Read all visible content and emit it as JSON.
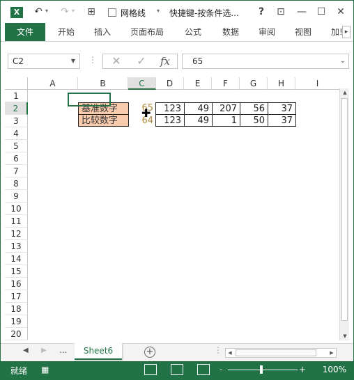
{
  "titlebar": {
    "logo": "X",
    "gridlines_label": "网格线",
    "doc_title": "快捷键-按条件选...",
    "help": "?",
    "ribbon_display": "⊡",
    "minimize": "—",
    "maximize": "☐",
    "close": "✕"
  },
  "ribbon": {
    "tabs": [
      "文件",
      "开始",
      "插入",
      "页面布局",
      "公式",
      "数据",
      "审阅",
      "视图",
      "加!"
    ]
  },
  "formula_bar": {
    "name_box": "C2",
    "cancel": "✕",
    "enter": "✓",
    "fx": "fx",
    "value": "65"
  },
  "grid": {
    "columns": [
      "A",
      "B",
      "C",
      "D",
      "E",
      "F",
      "G",
      "H",
      "I"
    ],
    "rows": [
      "1",
      "2",
      "3",
      "4",
      "5",
      "6",
      "7",
      "8",
      "9",
      "10",
      "11",
      "12",
      "13",
      "14",
      "15",
      "16",
      "17",
      "18",
      "19",
      "20"
    ],
    "active_cell": "C2",
    "row2": {
      "label": "基准数字",
      "c": "65",
      "d": "123",
      "e": "49",
      "f": "207",
      "g": "56",
      "h": "37"
    },
    "row3": {
      "label": "比较数字",
      "c": "64",
      "d": "123",
      "e": "49",
      "f": "1",
      "g": "50",
      "h": "37"
    }
  },
  "sheet_tabs": {
    "more": "...",
    "active": "Sheet6",
    "add": "+"
  },
  "status_bar": {
    "ready": "就绪",
    "zoom": "100%",
    "zoom_minus": "-",
    "zoom_plus": "+"
  },
  "colors": {
    "accent": "#217346",
    "label_fill": "#f8cbad"
  }
}
